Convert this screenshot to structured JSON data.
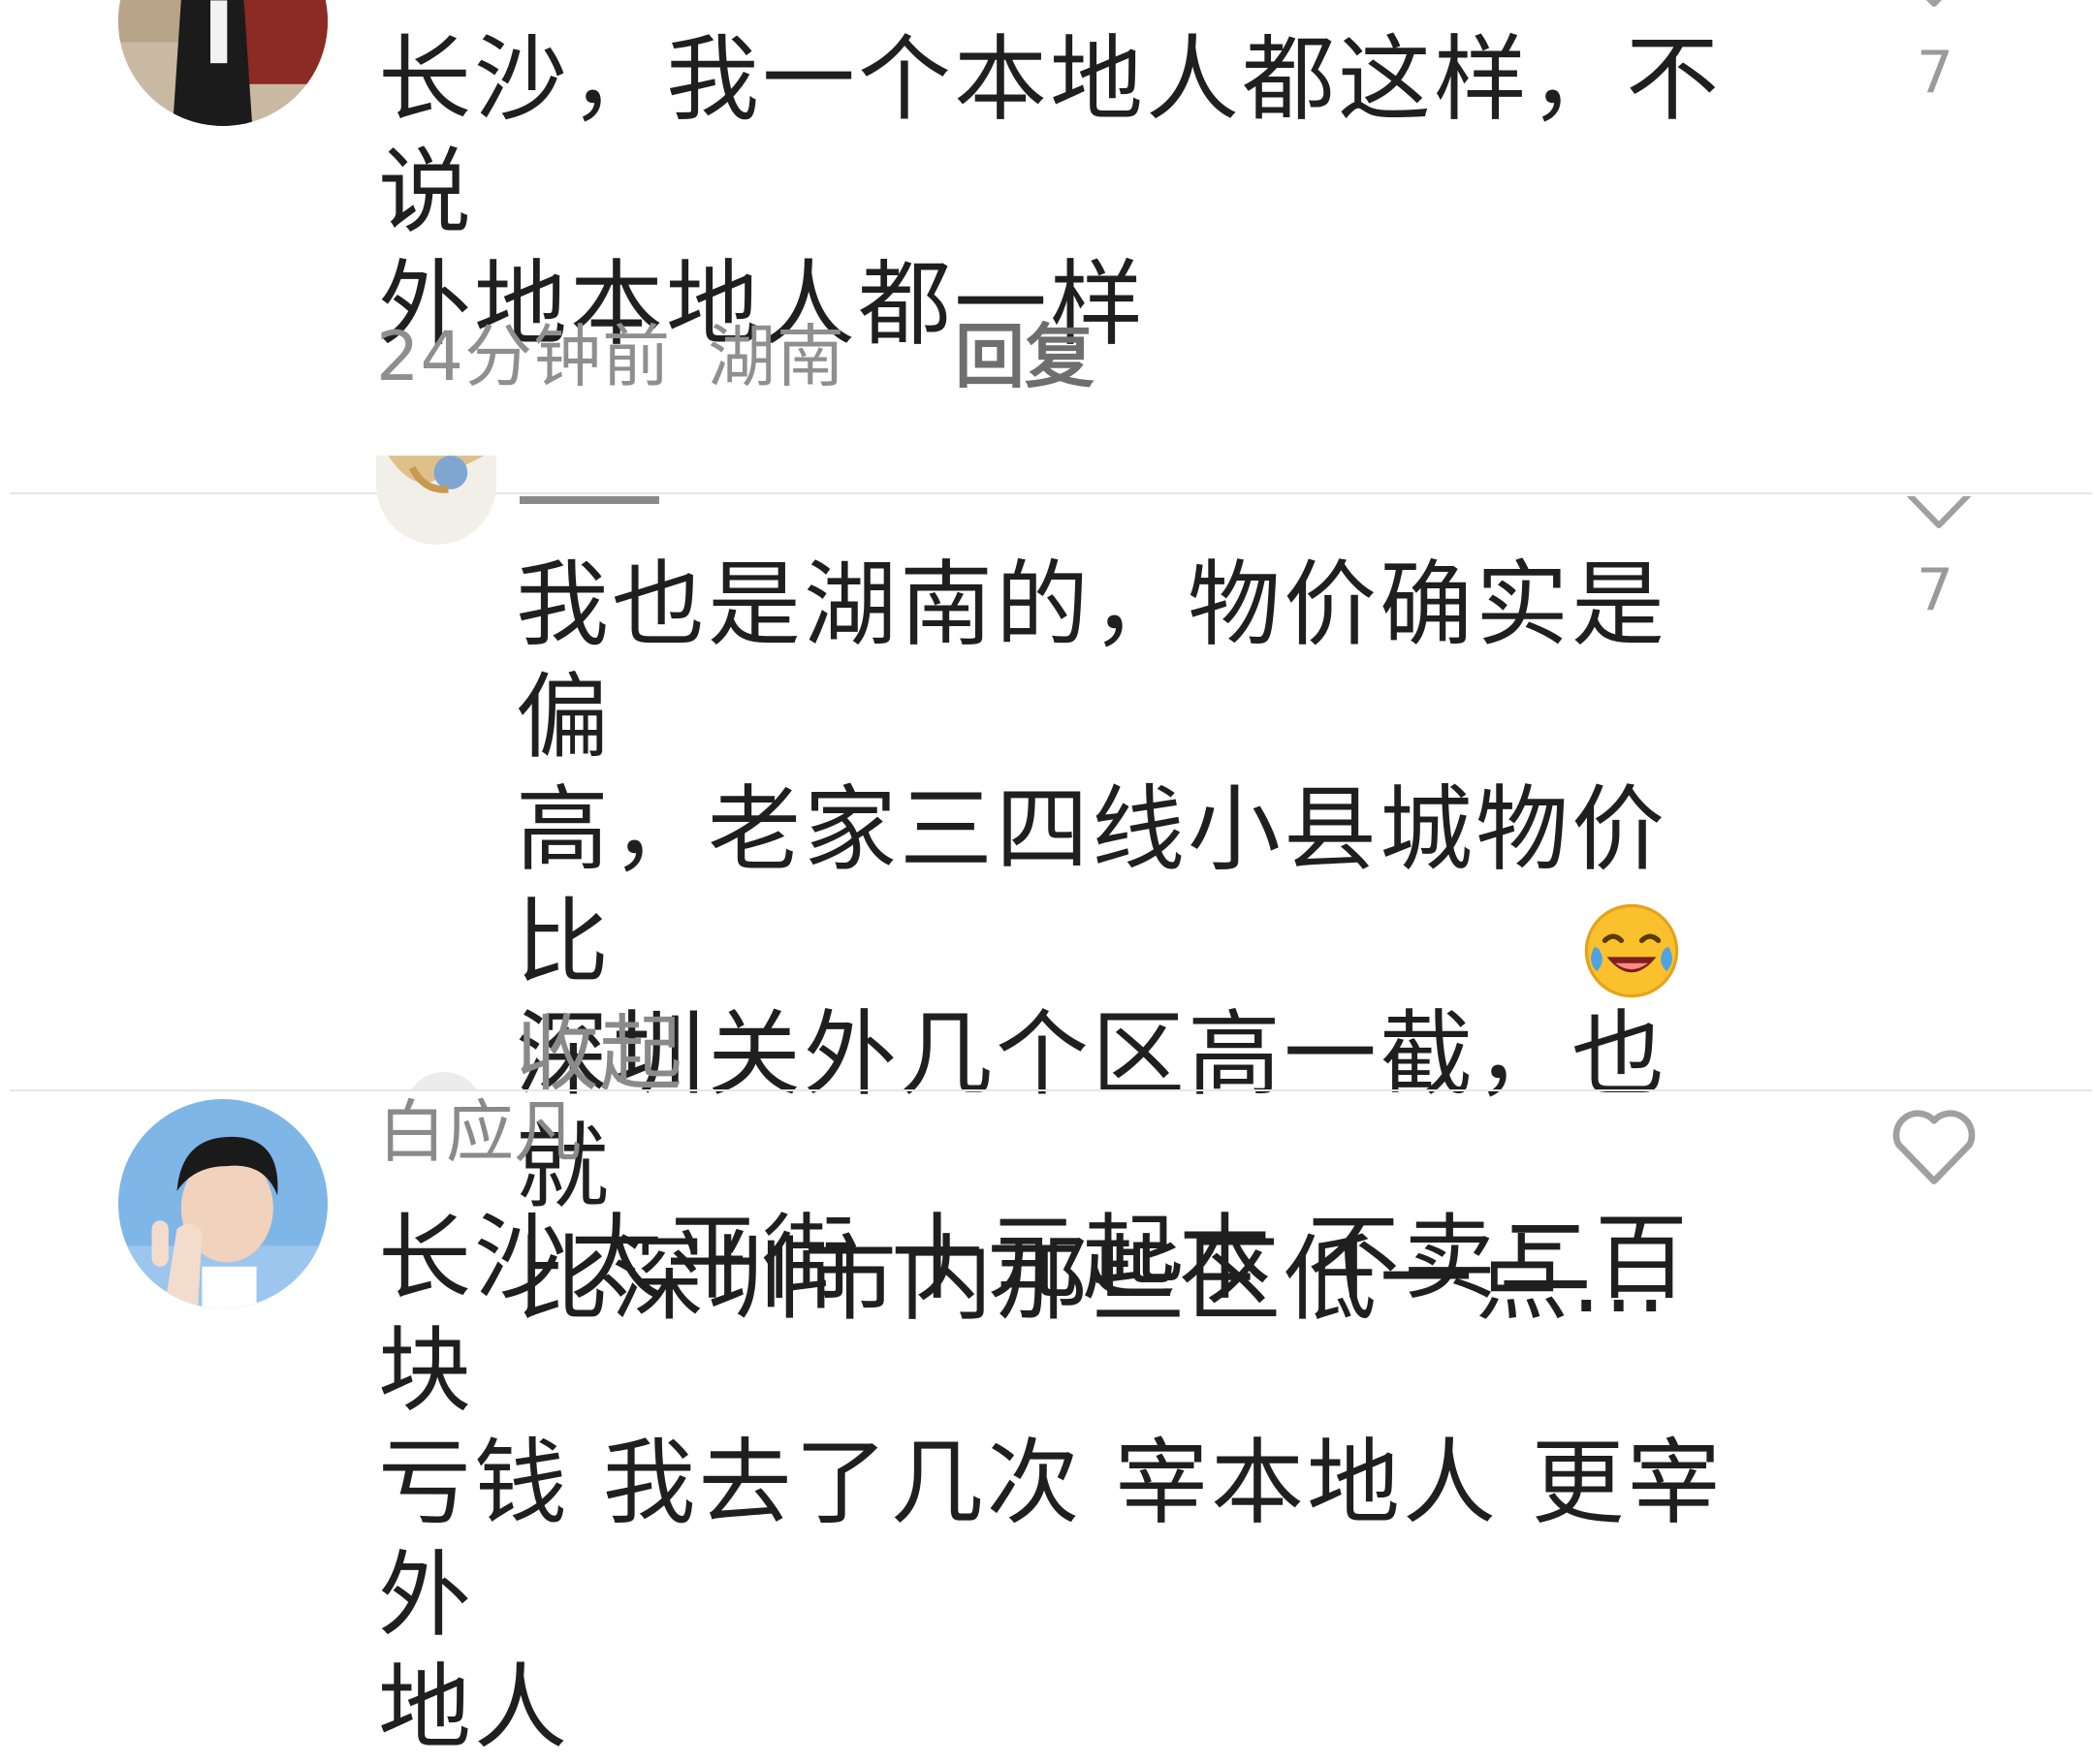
{
  "comments": [
    {
      "username": "",
      "text": "长沙，我一个本地人都这样，不说\n外地本地人都一样",
      "time": "24分钟前",
      "location": "湖南",
      "reply_label": "回复",
      "likes": "7"
    },
    {
      "username": "一一",
      "text": "我也是湖南的，物价确实是偏\n高，老家三四线小县城物价比\n深圳关外几个区高一截，也就\n比深圳市内那些区低一点...",
      "emoji": "laughing-crying-face",
      "collapse_label": "收起",
      "likes": "7"
    },
    {
      "username": "白应凡",
      "text": "长沙太平街 十元起本 不卖二百块\n亏钱 我去了几次 宰本地人 更宰外\n地人",
      "likes": ""
    }
  ],
  "colors": {
    "text": "#1f1f1f",
    "meta": "#8f8f8f",
    "icon": "#a0a0a0",
    "divider": "#e6e6e6"
  }
}
